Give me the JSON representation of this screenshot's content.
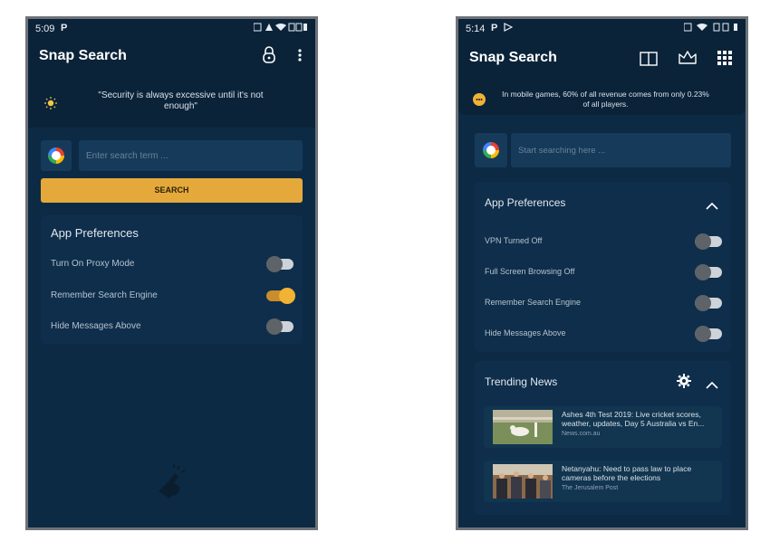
{
  "phone_a": {
    "status": {
      "time": "5:09",
      "left_icon_text": "P"
    },
    "app_title": "Snap Search",
    "message": "\"Security is always excessive until it's not enough\"",
    "search_placeholder": "Enter search term ...",
    "search_button": "SEARCH",
    "preferences": {
      "title": "App Preferences",
      "items": [
        {
          "label": "Turn On Proxy Mode",
          "on": false
        },
        {
          "label": "Remember Search Engine",
          "on": true
        },
        {
          "label": "Hide Messages Above",
          "on": false
        }
      ]
    }
  },
  "phone_b": {
    "status": {
      "time": "5:14",
      "left_icon_text": "P"
    },
    "app_title": "Snap Search",
    "message": "In mobile games, 60% of all revenue comes from only 0.23% of all players.",
    "search_placeholder": "Start searching here ...",
    "preferences": {
      "title": "App Preferences",
      "items": [
        {
          "label": "VPN Turned Off",
          "on": false
        },
        {
          "label": "Full Screen Browsing Off",
          "on": false
        },
        {
          "label": "Remember Search Engine",
          "on": false
        },
        {
          "label": "Hide Messages Above",
          "on": false
        }
      ]
    },
    "news": {
      "title": "Trending News",
      "items": [
        {
          "title": "Ashes 4th Test 2019: Live cricket scores, weather, updates, Day 5 Australia vs En...",
          "source": "News.com.au"
        },
        {
          "title": "Netanyahu: Need to pass law to place cameras before the elections",
          "source": "The Jerusalem Post"
        }
      ]
    }
  },
  "colors": {
    "background": "#0c2a44",
    "card": "#0e2e4b",
    "accent": "#e5a93b",
    "toggle_on": "#f2b233"
  }
}
